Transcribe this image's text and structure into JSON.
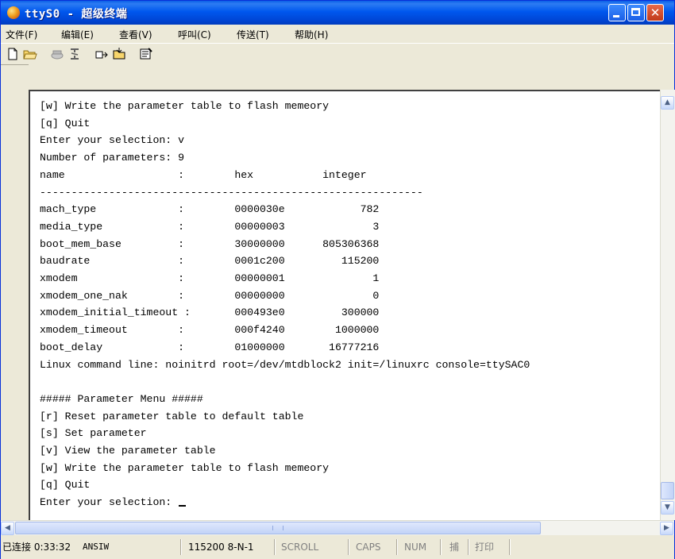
{
  "window": {
    "title": "ttyS0 - 超级终端",
    "accent_color": "#0054e3"
  },
  "menu": [
    {
      "label": "文件(F)"
    },
    {
      "label": "编辑(E)"
    },
    {
      "label": "查看(V)"
    },
    {
      "label": "呼叫(C)"
    },
    {
      "label": "传送(T)"
    },
    {
      "label": "帮助(H)"
    }
  ],
  "toolbar": {
    "icons": [
      "new-document-icon",
      "open-folder-icon",
      "call-icon",
      "disconnect-icon",
      "send-icon",
      "receive-icon",
      "properties-icon"
    ]
  },
  "terminal": {
    "lines": [
      "[w] Write the parameter table to flash memeory",
      "[q] Quit",
      "Enter your selection: v",
      "Number of parameters: 9",
      "name                  :        hex           integer",
      "-------------------------------------------------------------",
      "mach_type             :        0000030e            782",
      "media_type            :        00000003              3",
      "boot_mem_base         :        30000000      805306368",
      "baudrate              :        0001c200         115200",
      "xmodem                :        00000001              1",
      "xmodem_one_nak        :        00000000              0",
      "xmodem_initial_timeout :       000493e0         300000",
      "xmodem_timeout        :        000f4240        1000000",
      "boot_delay            :        01000000       16777216",
      "Linux command line: noinitrd root=/dev/mtdblock2 init=/linuxrc console=ttySAC0",
      "",
      "##### Parameter Menu #####",
      "[r] Reset parameter table to default table",
      "[s] Set parameter",
      "[v] View the parameter table",
      "[w] Write the parameter table to flash memeory",
      "[q] Quit",
      "Enter your selection: "
    ]
  },
  "status": {
    "connection": "已连接 0:33:32",
    "emulation": "ANSIW",
    "port_settings": "115200 8-N-1",
    "scroll": "SCROLL",
    "caps": "CAPS",
    "num": "NUM",
    "capture": "捕",
    "print": "打印"
  }
}
